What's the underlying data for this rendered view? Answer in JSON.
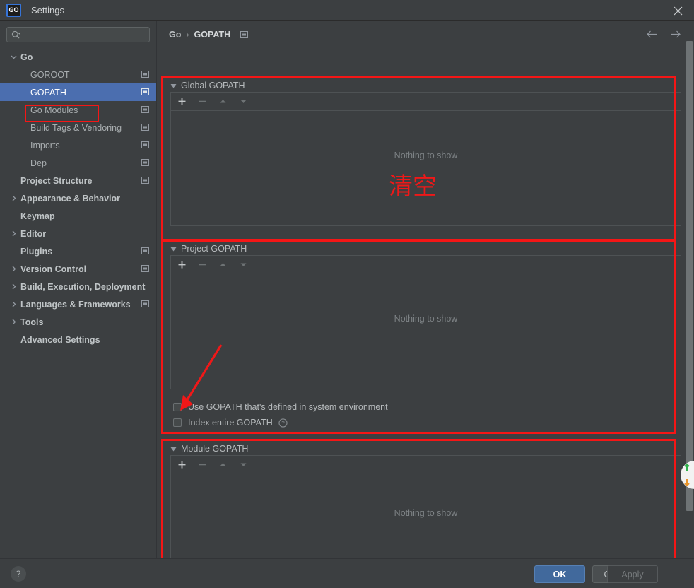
{
  "window": {
    "title": "Settings",
    "logo_text": "GO",
    "close_label": "✕"
  },
  "search": {
    "value": "",
    "placeholder": ""
  },
  "sidebar": {
    "items": [
      {
        "label": "Go",
        "level": 0,
        "twisty": "chevron-down-icon",
        "bold": true,
        "selected": false,
        "proj_icon": false
      },
      {
        "label": "GOROOT",
        "level": 1,
        "twisty": "none",
        "bold": false,
        "selected": false,
        "proj_icon": true
      },
      {
        "label": "GOPATH",
        "level": 1,
        "twisty": "none",
        "bold": false,
        "selected": true,
        "proj_icon": true
      },
      {
        "label": "Go Modules",
        "level": 1,
        "twisty": "none",
        "bold": false,
        "selected": false,
        "proj_icon": true
      },
      {
        "label": "Build Tags & Vendoring",
        "level": 1,
        "twisty": "none",
        "bold": false,
        "selected": false,
        "proj_icon": true
      },
      {
        "label": "Imports",
        "level": 1,
        "twisty": "none",
        "bold": false,
        "selected": false,
        "proj_icon": true
      },
      {
        "label": "Dep",
        "level": 1,
        "twisty": "none",
        "bold": false,
        "selected": false,
        "proj_icon": true
      },
      {
        "label": "Project Structure",
        "level": 0,
        "twisty": "none",
        "bold": true,
        "selected": false,
        "proj_icon": true
      },
      {
        "label": "Appearance & Behavior",
        "level": 0,
        "twisty": "chevron-right-icon",
        "bold": true,
        "selected": false,
        "proj_icon": false
      },
      {
        "label": "Keymap",
        "level": 0,
        "twisty": "none",
        "bold": true,
        "selected": false,
        "proj_icon": false
      },
      {
        "label": "Editor",
        "level": 0,
        "twisty": "chevron-right-icon",
        "bold": true,
        "selected": false,
        "proj_icon": false
      },
      {
        "label": "Plugins",
        "level": 0,
        "twisty": "none",
        "bold": true,
        "selected": false,
        "proj_icon": true
      },
      {
        "label": "Version Control",
        "level": 0,
        "twisty": "chevron-right-icon",
        "bold": true,
        "selected": false,
        "proj_icon": true
      },
      {
        "label": "Build, Execution, Deployment",
        "level": 0,
        "twisty": "chevron-right-icon",
        "bold": true,
        "selected": false,
        "proj_icon": false
      },
      {
        "label": "Languages & Frameworks",
        "level": 0,
        "twisty": "chevron-right-icon",
        "bold": true,
        "selected": false,
        "proj_icon": true
      },
      {
        "label": "Tools",
        "level": 0,
        "twisty": "chevron-right-icon",
        "bold": true,
        "selected": false,
        "proj_icon": false
      },
      {
        "label": "Advanced Settings",
        "level": 0,
        "twisty": "none",
        "bold": true,
        "selected": false,
        "proj_icon": false
      }
    ]
  },
  "breadcrumb": {
    "root": "Go",
    "separator": "›",
    "current": "GOPATH"
  },
  "sections": {
    "global": {
      "title": "Global GOPATH",
      "empty_text": "Nothing to show",
      "toolbar": {
        "add": "+",
        "remove": "−",
        "up": "▲",
        "down": "▼"
      }
    },
    "project": {
      "title": "Project GOPATH",
      "empty_text": "Nothing to show",
      "toolbar": {
        "add": "+",
        "remove": "−",
        "up": "▲",
        "down": "▼"
      },
      "checkboxes": [
        {
          "label": "Use GOPATH that's defined in system environment",
          "checked": false,
          "help": false
        },
        {
          "label": "Index entire GOPATH",
          "checked": false,
          "help": true
        }
      ]
    },
    "module": {
      "title": "Module GOPATH",
      "empty_text": "Nothing to show",
      "toolbar": {
        "add": "+",
        "remove": "−",
        "up": "▲",
        "down": "▼"
      }
    }
  },
  "annotations": {
    "clear_text": "清空",
    "highlight_color": "#f51616"
  },
  "footer": {
    "help": "?",
    "ok": "OK",
    "cancel": "Cancel",
    "apply": "Apply"
  }
}
